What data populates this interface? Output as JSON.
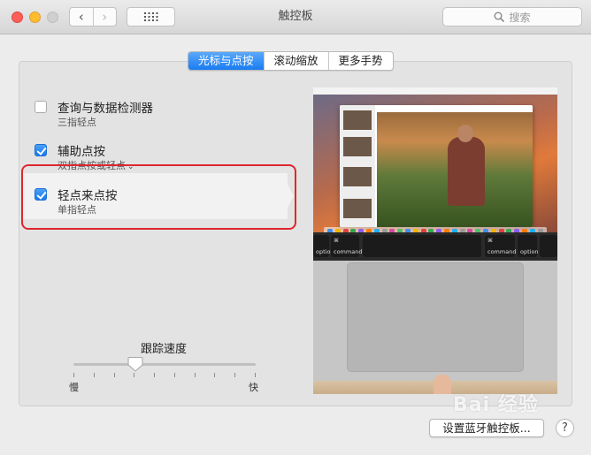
{
  "window": {
    "title": "触控板",
    "search_placeholder": "搜索"
  },
  "tabs": [
    {
      "label": "光标与点按",
      "active": true
    },
    {
      "label": "滚动缩放",
      "active": false
    },
    {
      "label": "更多手势",
      "active": false
    }
  ],
  "options": [
    {
      "label": "查询与数据检测器",
      "sub": "三指轻点",
      "checked": false
    },
    {
      "label": "辅助点按",
      "sub": "双指点按或轻点",
      "checked": true,
      "has_dropdown": true
    },
    {
      "label": "轻点来点按",
      "sub": "单指轻点",
      "checked": true,
      "selected": true
    }
  ],
  "tracking": {
    "label": "跟踪速度",
    "min_label": "慢",
    "max_label": "快",
    "value_fraction": 0.34,
    "tick_count": 10
  },
  "preview": {
    "touchbar_keys": [
      "option",
      "command",
      "command",
      "option"
    ]
  },
  "footer": {
    "setup_button": "设置蓝牙触控板...",
    "help_button": "?"
  },
  "watermark": "Bai 经验",
  "colors": {
    "accent": "#1a7cf2",
    "highlight_border": "#e0262d"
  }
}
